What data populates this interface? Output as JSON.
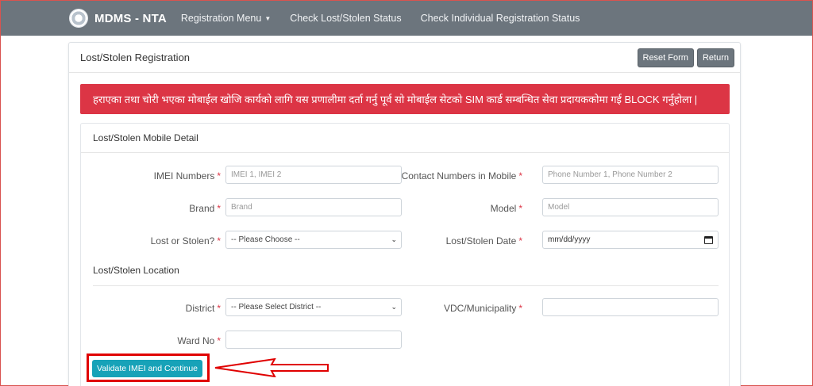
{
  "navbar": {
    "brand": "MDMS - NTA",
    "links": [
      {
        "label": "Registration Menu",
        "dropdown": true
      },
      {
        "label": "Check Lost/Stolen Status"
      },
      {
        "label": "Check Individual Registration Status"
      }
    ]
  },
  "card": {
    "title": "Lost/Stolen Registration",
    "reset_label": "Reset Form",
    "return_label": "Return"
  },
  "alert": {
    "text": "हराएका तथा चोरी भएका मोबाईल खोजि कार्यको लागि यस प्रणालीमा दर्ता गर्नु पूर्व सो मोबाईल सेटको SIM कार्ड सम्बन्धित सेवा प्रदायककोमा गई BLOCK गर्नुहोला |"
  },
  "detail": {
    "heading": "Lost/Stolen Mobile Detail",
    "imei": {
      "label": "IMEI Numbers",
      "placeholder": "IMEI 1, IMEI 2"
    },
    "contact": {
      "label": "Contact Numbers in Mobile",
      "placeholder": "Phone Number 1, Phone Number 2"
    },
    "brand": {
      "label": "Brand",
      "placeholder": "Brand"
    },
    "model": {
      "label": "Model",
      "placeholder": "Model"
    },
    "lost_or_stolen": {
      "label": "Lost or Stolen?",
      "value": "-- Please Choose --"
    },
    "date": {
      "label": "Lost/Stolen Date",
      "value": "mm/dd/yyyy"
    }
  },
  "location": {
    "heading": "Lost/Stolen Location",
    "district": {
      "label": "District",
      "value": "-- Please Select District --"
    },
    "vdc": {
      "label": "VDC/Municipality",
      "value": ""
    },
    "ward": {
      "label": "Ward No",
      "value": ""
    }
  },
  "required_mark": "*",
  "validate_label": "Validate IMEI and Continue",
  "colors": {
    "navbar": "#6c757d",
    "alert": "#dc3545",
    "primary_button": "#17a2b8",
    "highlight": "#e00000"
  }
}
